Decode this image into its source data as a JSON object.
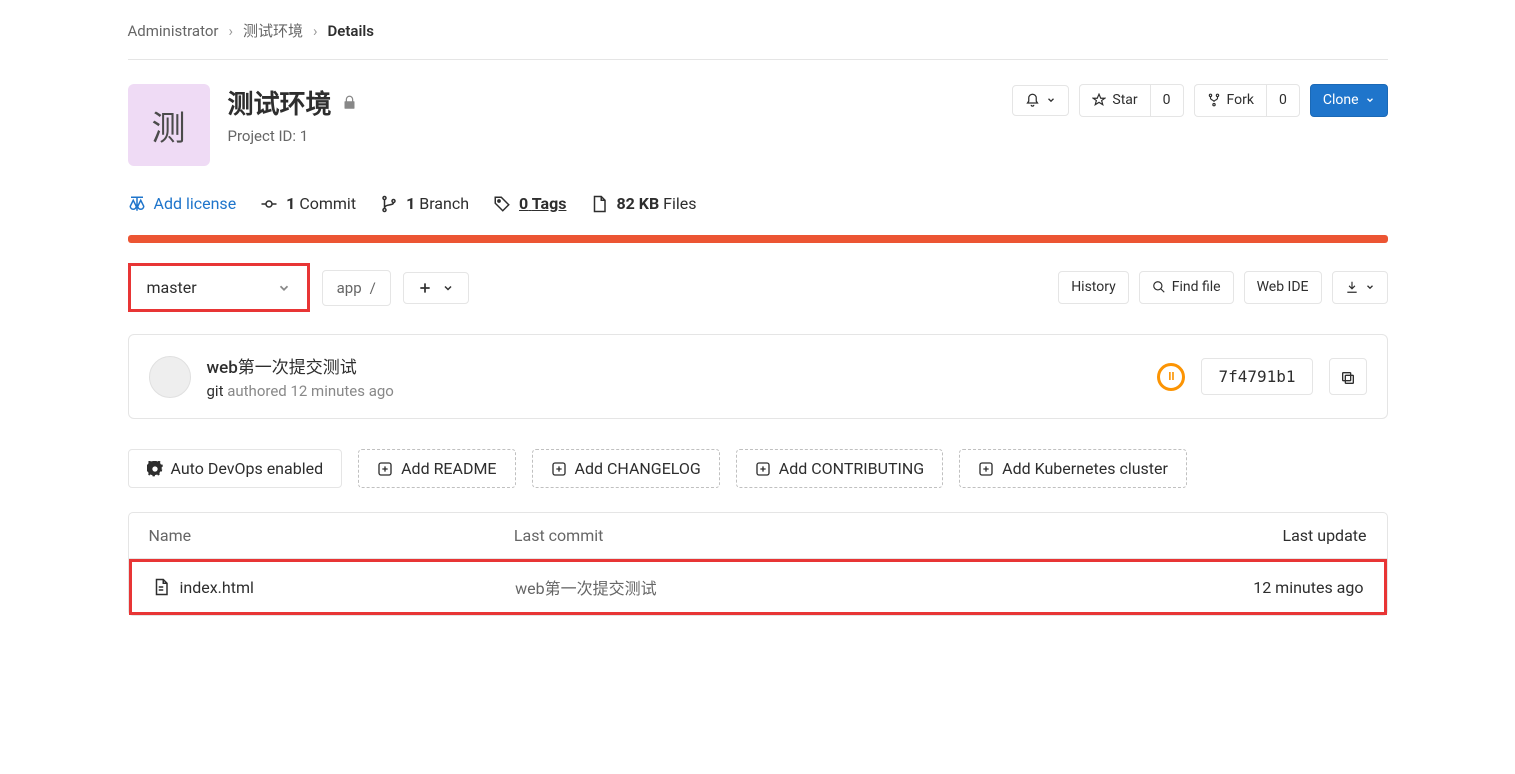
{
  "breadcrumb": {
    "root": "Administrator",
    "project": "测试环境",
    "current": "Details"
  },
  "project": {
    "avatar_char": "测",
    "name": "测试环境",
    "id_label": "Project ID: 1"
  },
  "header_actions": {
    "star": {
      "label": "Star",
      "count": "0"
    },
    "fork": {
      "label": "Fork",
      "count": "0"
    },
    "clone": "Clone"
  },
  "stats": {
    "add_license": "Add license",
    "commits": {
      "count": "1",
      "label": "Commit"
    },
    "branches": {
      "count": "1",
      "label": "Branch"
    },
    "tags": {
      "count": "0",
      "label": "Tags"
    },
    "files": {
      "size": "82 KB",
      "label": "Files"
    }
  },
  "branch_row": {
    "branch": "master",
    "path": "app",
    "history": "History",
    "find_file": "Find file",
    "web_ide": "Web IDE"
  },
  "last_commit": {
    "title": "web第一次提交测试",
    "author": "git",
    "authored": "authored",
    "time": "12 minutes ago",
    "status_icon": "II",
    "sha": "7f4791b1"
  },
  "quick_actions": {
    "autodevops": "Auto DevOps enabled",
    "add_readme": "Add README",
    "add_changelog": "Add CHANGELOG",
    "add_contributing": "Add CONTRIBUTING",
    "add_k8s": "Add Kubernetes cluster"
  },
  "file_table": {
    "head": {
      "name": "Name",
      "commit": "Last commit",
      "update": "Last update"
    },
    "rows": [
      {
        "name": "index.html",
        "commit": "web第一次提交测试",
        "update": "12 minutes ago"
      }
    ]
  }
}
